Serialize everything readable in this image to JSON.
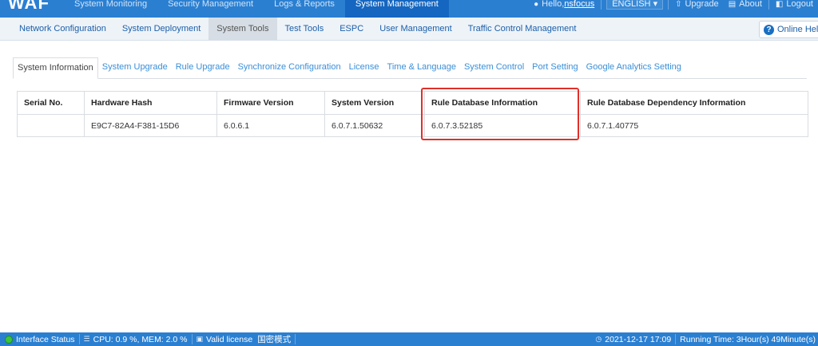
{
  "app": {
    "logo": "WAF"
  },
  "top_nav": [
    {
      "label": "System Monitoring",
      "active": false
    },
    {
      "label": "Security Management",
      "active": false
    },
    {
      "label": "Logs & Reports",
      "active": false
    },
    {
      "label": "System Management",
      "active": true
    }
  ],
  "top_right": {
    "user_prefix": "Hello,",
    "user_name": "nsfocus",
    "language": "ENGLISH",
    "upgrade": "Upgrade",
    "about": "About",
    "logout": "Logout"
  },
  "sub_nav": [
    {
      "label": "Network Configuration",
      "active": false
    },
    {
      "label": "System Deployment",
      "active": false
    },
    {
      "label": "System Tools",
      "active": true
    },
    {
      "label": "Test Tools",
      "active": false
    },
    {
      "label": "ESPC",
      "active": false
    },
    {
      "label": "User Management",
      "active": false
    },
    {
      "label": "Traffic Control Management",
      "active": false
    }
  ],
  "help": {
    "label": "Online Help"
  },
  "tabs": [
    {
      "label": "System Information",
      "active": true
    },
    {
      "label": "System Upgrade",
      "active": false
    },
    {
      "label": "Rule Upgrade",
      "active": false
    },
    {
      "label": "Synchronize Configuration",
      "active": false
    },
    {
      "label": "License",
      "active": false
    },
    {
      "label": "Time & Language",
      "active": false
    },
    {
      "label": "System Control",
      "active": false
    },
    {
      "label": "Port Setting",
      "active": false
    },
    {
      "label": "Google Analytics Setting",
      "active": false
    }
  ],
  "table": {
    "headers": [
      "Serial No.",
      "Hardware Hash",
      "Firmware Version",
      "System Version",
      "Rule Database Information",
      "Rule Database Dependency Information"
    ],
    "rows": [
      [
        "",
        "E9C7-82A4-F381-15D6",
        "6.0.6.1",
        "6.0.7.1.50632",
        "6.0.7.3.52185",
        "6.0.7.1.40775"
      ]
    ]
  },
  "status_bar": {
    "interface_status": "Interface Status",
    "cpu_mem": "CPU:  0.9 %, MEM:  2.0 %",
    "license": "Valid license",
    "mode": "国密模式",
    "datetime": "2021-12-17 17:09",
    "running_time": "Running Time:  3Hour(s) 49Minute(s)"
  },
  "colors": {
    "nav_blue": "#2b7fd1",
    "nav_active": "#1566c0",
    "link_blue": "#3a8fd8",
    "highlight_red": "#e0302a"
  },
  "icons": {
    "user": "user-icon",
    "language_dropdown": "chevron-down-icon",
    "upgrade": "upgrade-icon",
    "about": "about-icon",
    "logout": "logout-icon",
    "help": "help-icon",
    "interface_status": "status-dot-icon",
    "cpu": "cpu-icon",
    "license": "license-icon",
    "clock": "clock-icon"
  }
}
